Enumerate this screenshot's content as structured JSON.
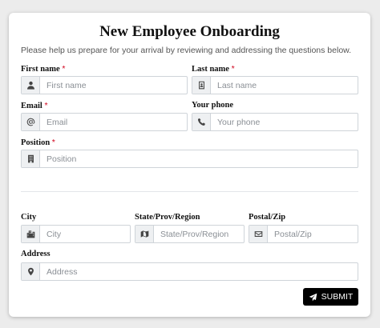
{
  "form": {
    "title": "New Employee Onboarding",
    "subtitle": "Please help us prepare for your arrival by reviewing and addressing the questions below.",
    "required_marker": "*",
    "fields": {
      "first_name": {
        "label": "First name",
        "placeholder": "First name",
        "value": "",
        "icon": "user-icon"
      },
      "last_name": {
        "label": "Last name",
        "placeholder": "Last name",
        "value": "",
        "icon": "id-card-icon"
      },
      "email": {
        "label": "Email",
        "placeholder": "Email",
        "value": "",
        "icon": "at-icon"
      },
      "phone": {
        "label": "Your phone",
        "placeholder": "Your phone",
        "value": "",
        "icon": "phone-icon"
      },
      "position": {
        "label": "Position",
        "placeholder": "Position",
        "value": "",
        "icon": "building-icon"
      },
      "city": {
        "label": "City",
        "placeholder": "City",
        "value": "",
        "icon": "city-icon"
      },
      "state": {
        "label": "State/Prov/Region",
        "placeholder": "State/Prov/Region",
        "value": "",
        "icon": "map-icon"
      },
      "postal": {
        "label": "Postal/Zip",
        "placeholder": "Postal/Zip",
        "value": "",
        "icon": "envelope-icon"
      },
      "address": {
        "label": "Address",
        "placeholder": "Address",
        "value": "",
        "icon": "map-pin-icon"
      }
    },
    "submit_label": "SUBMIT"
  }
}
